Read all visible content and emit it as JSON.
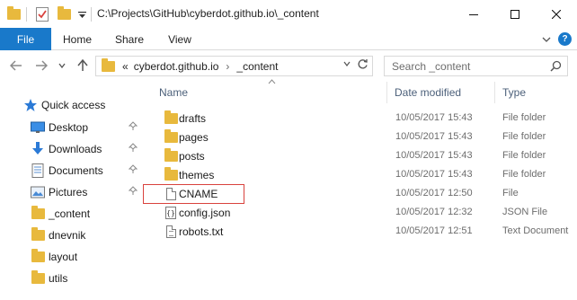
{
  "window": {
    "title": "C:\\Projects\\GitHub\\cyberdot.github.io\\_content",
    "controls": {
      "minimize": "—",
      "maximize": "☐",
      "close": "✕"
    }
  },
  "ribbon": {
    "tabs": [
      "File",
      "Home",
      "Share",
      "View"
    ]
  },
  "address": {
    "overflow": "«",
    "segments": [
      "cyberdot.github.io",
      "_content"
    ],
    "separator": "›"
  },
  "search": {
    "placeholder": "Search _content"
  },
  "navpane": {
    "quick_access": "Quick access",
    "items": [
      {
        "label": "Desktop",
        "icon": "desktop-icon",
        "pinned": true
      },
      {
        "label": "Downloads",
        "icon": "downloads-icon",
        "pinned": true
      },
      {
        "label": "Documents",
        "icon": "documents-icon",
        "pinned": true
      },
      {
        "label": "Pictures",
        "icon": "pictures-icon",
        "pinned": true
      },
      {
        "label": "_content",
        "icon": "folder-icon",
        "pinned": false
      },
      {
        "label": "dnevnik",
        "icon": "folder-icon",
        "pinned": false
      },
      {
        "label": "layout",
        "icon": "folder-icon",
        "pinned": false
      },
      {
        "label": "utils",
        "icon": "folder-icon",
        "pinned": false
      }
    ]
  },
  "columns": [
    "Name",
    "Date modified",
    "Type"
  ],
  "files": [
    {
      "name": "drafts",
      "date": "10/05/2017 15:43",
      "type": "File folder",
      "icon": "folder-icon"
    },
    {
      "name": "pages",
      "date": "10/05/2017 15:43",
      "type": "File folder",
      "icon": "folder-icon"
    },
    {
      "name": "posts",
      "date": "10/05/2017 15:43",
      "type": "File folder",
      "icon": "folder-icon"
    },
    {
      "name": "themes",
      "date": "10/05/2017 15:43",
      "type": "File folder",
      "icon": "folder-icon"
    },
    {
      "name": "CNAME",
      "date": "10/05/2017 12:50",
      "type": "File",
      "icon": "file-icon"
    },
    {
      "name": "config.json",
      "date": "10/05/2017 12:32",
      "type": "JSON File",
      "icon": "json-file-icon"
    },
    {
      "name": "robots.txt",
      "date": "10/05/2017 12:51",
      "type": "Text Document",
      "icon": "text-file-icon"
    }
  ],
  "colors": {
    "file_tab": "#1979ca",
    "folder": "#e8b93d",
    "highlight": "#d9423d",
    "header_text": "#4c607a"
  }
}
